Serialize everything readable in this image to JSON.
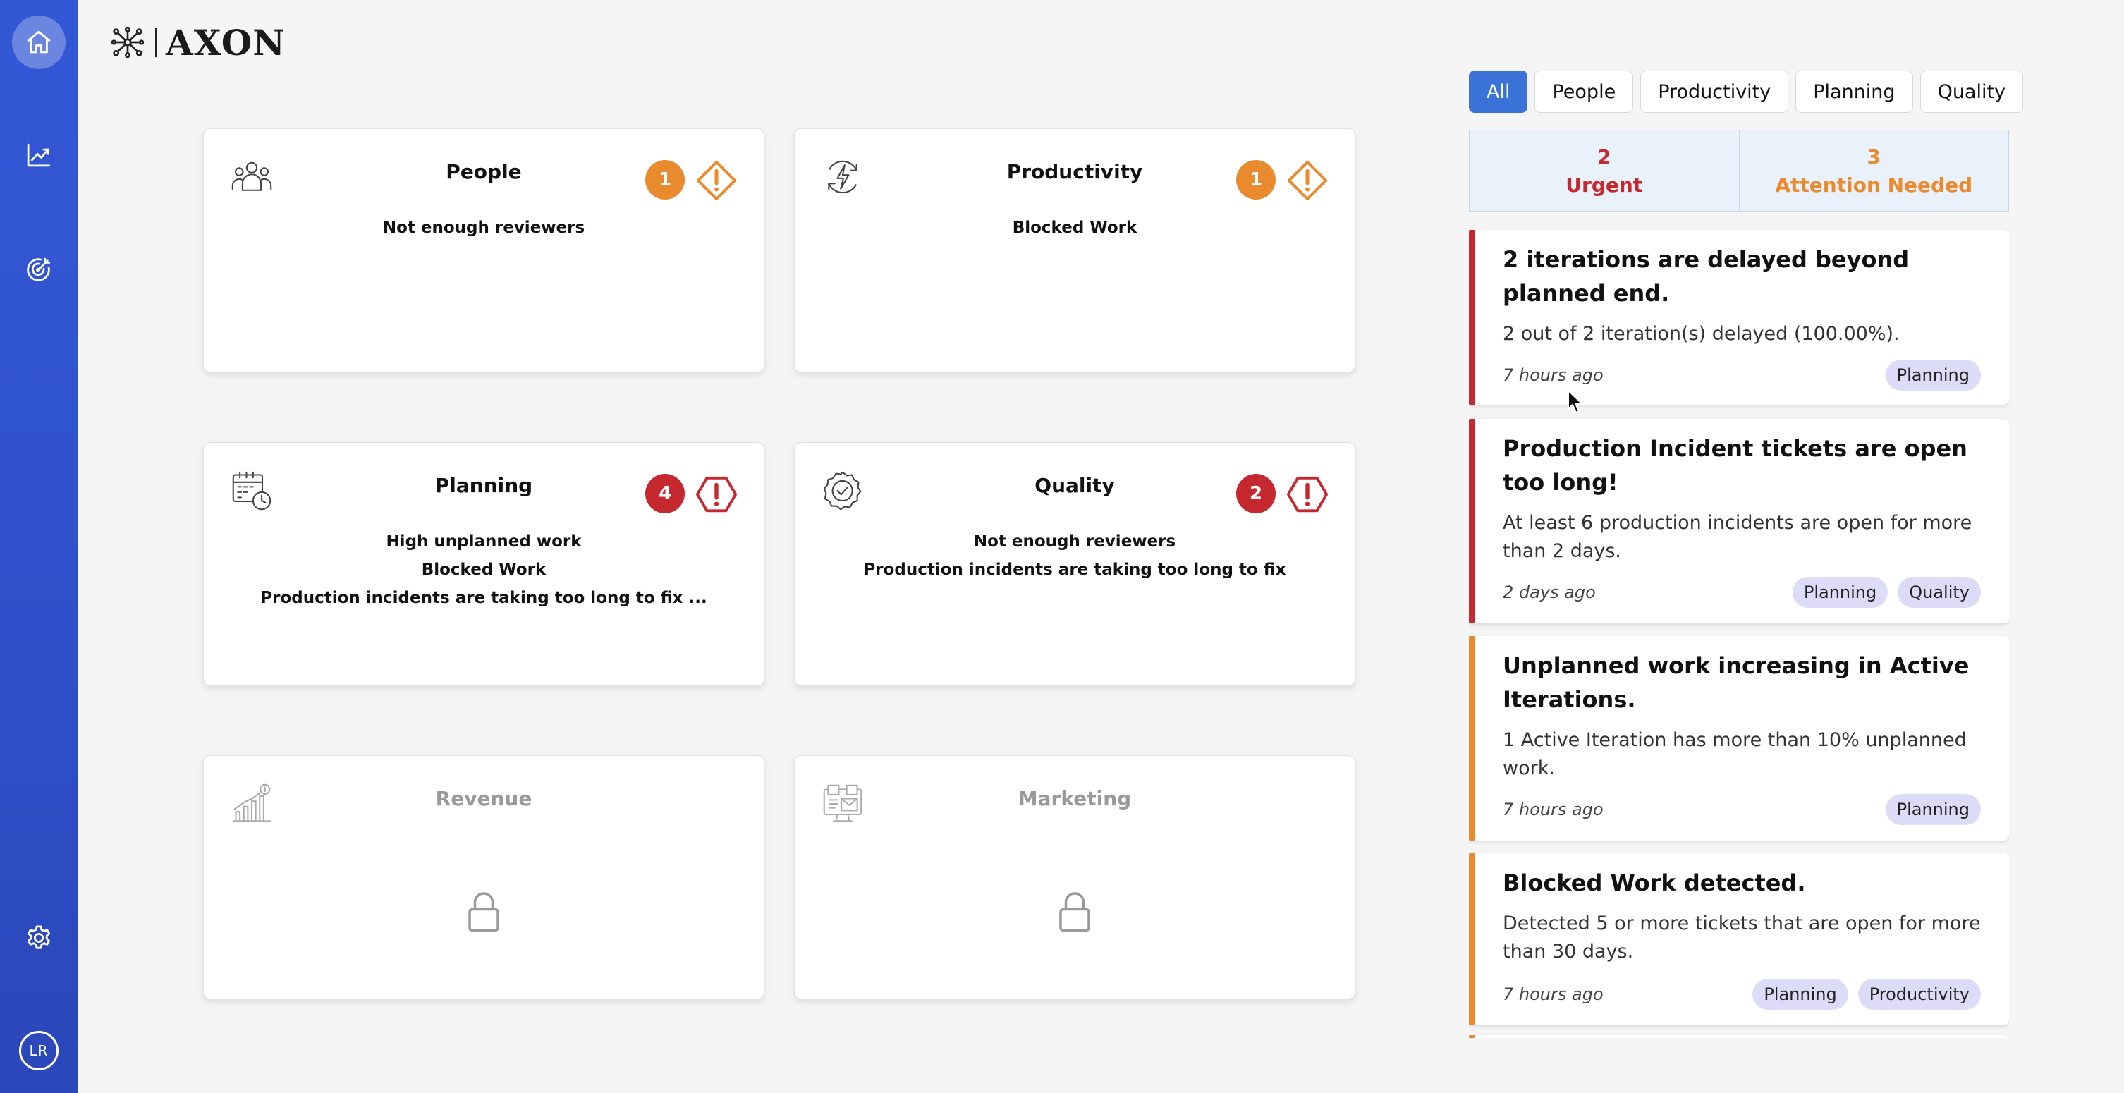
{
  "logo": {
    "text": "AXON"
  },
  "sidebar": {
    "items": [
      {
        "name": "home",
        "icon": "home-icon",
        "active": true
      },
      {
        "name": "analytics",
        "icon": "chart-trend-icon",
        "active": false
      },
      {
        "name": "goals",
        "icon": "target-icon",
        "active": false
      },
      {
        "name": "settings",
        "icon": "gear-icon",
        "active": false
      }
    ],
    "avatar_initials": "LR"
  },
  "cards": [
    {
      "title": "People",
      "icon": "people-icon",
      "count": "1",
      "severity": "warning",
      "issues": [
        "Not enough reviewers"
      ],
      "locked": false
    },
    {
      "title": "Productivity",
      "icon": "lightning-cycle-icon",
      "count": "1",
      "severity": "warning",
      "issues": [
        "Blocked Work"
      ],
      "locked": false
    },
    {
      "title": "Planning",
      "icon": "calendar-clock-icon",
      "count": "4",
      "severity": "urgent",
      "issues": [
        "High unplanned work",
        "Blocked Work",
        "Production incidents are taking too long to fix ..."
      ],
      "locked": false
    },
    {
      "title": "Quality",
      "icon": "badge-check-icon",
      "count": "2",
      "severity": "urgent",
      "issues": [
        "Not enough reviewers",
        "Production incidents are taking too long to fix"
      ],
      "locked": false
    },
    {
      "title": "Revenue",
      "icon": "bar-chart-dollar-icon",
      "locked": true
    },
    {
      "title": "Marketing",
      "icon": "monitor-marketing-icon",
      "locked": true
    }
  ],
  "filters": {
    "tabs": [
      "All",
      "People",
      "Productivity",
      "Planning",
      "Quality"
    ],
    "active": "All"
  },
  "summary": {
    "urgent_count": "2",
    "urgent_label": "Urgent",
    "attention_count": "3",
    "attention_label": "Attention Needed"
  },
  "alerts": [
    {
      "severity": "urgent",
      "title": "2 iterations are delayed beyond planned end.",
      "body": "2 out of 2 iteration(s) delayed (100.00%).",
      "time": "7 hours ago",
      "tags": [
        "Planning"
      ]
    },
    {
      "severity": "urgent",
      "title": "Production Incident tickets are open too long!",
      "body": "At least 6 production incidents are open for more than 2 days.",
      "time": "2 days ago",
      "tags": [
        "Planning",
        "Quality"
      ]
    },
    {
      "severity": "attention",
      "title": "Unplanned work increasing in Active Iterations.",
      "body": "1 Active Iteration has more than 10% unplanned work.",
      "time": "7 hours ago",
      "tags": [
        "Planning"
      ]
    },
    {
      "severity": "attention",
      "title": "Blocked Work detected.",
      "body": "Detected 5 or more tickets that are open for more than 30 days.",
      "time": "7 hours ago",
      "tags": [
        "Planning",
        "Productivity"
      ]
    }
  ],
  "colors": {
    "sidebar": "#3358d6",
    "accent": "#3a72d8",
    "urgent": "#c6282f",
    "attention": "#ea8a2f",
    "tag_bg": "#dcdcf8"
  }
}
